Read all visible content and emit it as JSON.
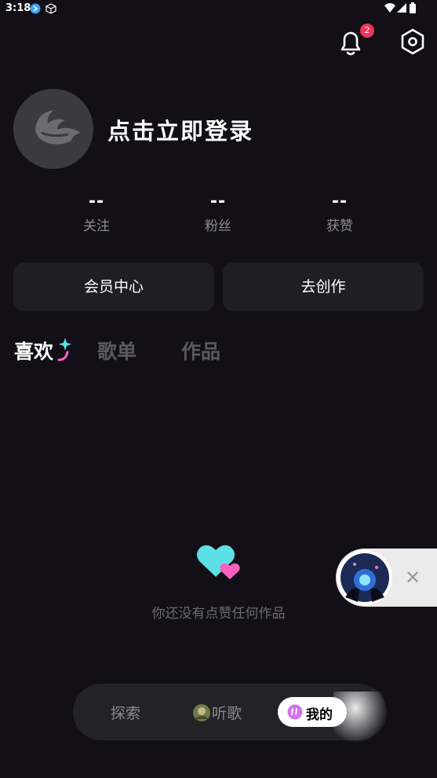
{
  "status": {
    "time": "3:18"
  },
  "notifications": {
    "count": "2"
  },
  "profile": {
    "login_label": "点击立即登录"
  },
  "stats": [
    {
      "value": "--",
      "label": "关注"
    },
    {
      "value": "--",
      "label": "粉丝"
    },
    {
      "value": "--",
      "label": "获赞"
    }
  ],
  "buttons": {
    "vip": "会员中心",
    "create": "去创作"
  },
  "tabs": [
    {
      "label": "喜欢"
    },
    {
      "label": "歌单"
    },
    {
      "label": "作品"
    }
  ],
  "empty": {
    "message": "你还没有点赞任何作品"
  },
  "bottom_nav": {
    "explore": "探索",
    "listen": "听歌",
    "me": "我的"
  },
  "colors": {
    "accent_cyan": "#5ce0e6",
    "accent_pink": "#ff5fc1",
    "badge": "#f0345a"
  }
}
